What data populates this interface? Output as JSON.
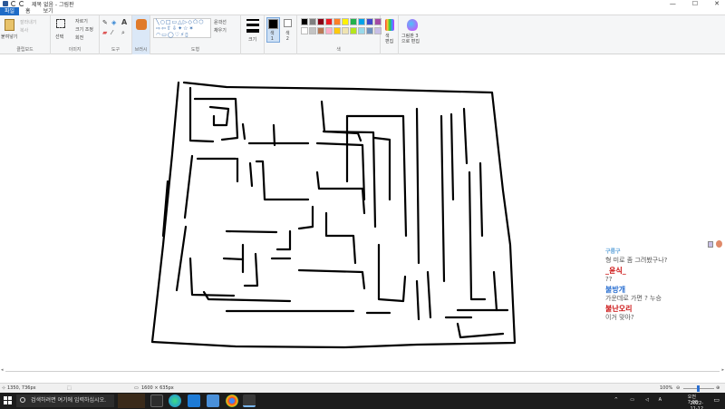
{
  "titlebar": {
    "title": "제목 없음 - 그림판",
    "minimize": "—",
    "maximize": "☐",
    "close": "✕"
  },
  "tabs": {
    "file": "파일",
    "home": "홈",
    "view": "보기"
  },
  "ribbon": {
    "clipboard": {
      "paste": "붙여넣기",
      "cut": "잘라내기",
      "copy": "복사",
      "label": "클립보드"
    },
    "image": {
      "select": "선택",
      "crop": "자르기",
      "resize": "크기 조정",
      "rotate": "회전",
      "label": "이미지"
    },
    "tools": {
      "label": "도구"
    },
    "brushes": {
      "label": "브러시"
    },
    "shapes": {
      "outline": "윤곽선",
      "fill": "채우기",
      "label": "도형"
    },
    "size": {
      "label": "크기"
    },
    "color1": "색\n1",
    "color2": "색\n2",
    "colors": {
      "label": "색"
    },
    "edit_colors": "색\n편집",
    "paint3d": "그림판 3\n으로 편집",
    "palette": [
      "#000000",
      "#7f7f7f",
      "#880015",
      "#ed1c24",
      "#ff7f27",
      "#fff200",
      "#22b14c",
      "#00a2e8",
      "#3f48cc",
      "#a349a4",
      "#ffffff",
      "#c3c3c3",
      "#b97a57",
      "#ffaec9",
      "#ffc90e",
      "#efe4b0",
      "#b5e61d",
      "#99d9ea",
      "#7092be",
      "#c8bfe7"
    ]
  },
  "chat": [
    {
      "name": "구름구",
      "name_color": "#5aa0d8",
      "msg": "형 미로 좀 그려봤구나?"
    },
    {
      "name": "_윤식_",
      "name_color": "#cc1111",
      "msg": "??"
    },
    {
      "name": "불방개",
      "name_color": "#2a6fd1",
      "msg": "가운데로 가면 ? 누승"
    },
    {
      "name": "불난오리",
      "name_color": "#cc1111",
      "msg": "이거 맞아?"
    }
  ],
  "statusbar": {
    "cursor": "1350, 736px",
    "selection": "",
    "canvas_size": "1600 × 635px",
    "zoom": "100%"
  },
  "taskbar": {
    "search_placeholder": "검색하려면 여기에 입력하십시오.",
    "time": "오전 7:08",
    "date": "2022-11-12",
    "lang": "A"
  }
}
